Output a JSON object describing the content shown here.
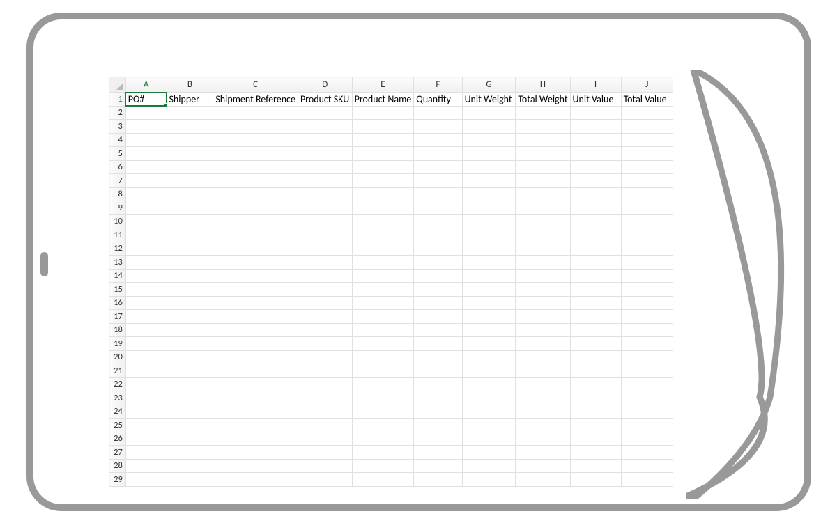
{
  "columns": [
    "A",
    "B",
    "C",
    "D",
    "E",
    "F",
    "G",
    "H",
    "I",
    "J"
  ],
  "row_count": 30,
  "selected_cell": {
    "row": 1,
    "col": "A"
  },
  "cells": {
    "1": {
      "A": "PO#",
      "B": "Shipper",
      "C": "Shipment Reference",
      "D": "Product SKU",
      "E": "Product Name",
      "F": "Quantity",
      "G": "Unit Weight",
      "H": "Total Weight",
      "I": "Unit Value",
      "J": "Total Value"
    }
  }
}
